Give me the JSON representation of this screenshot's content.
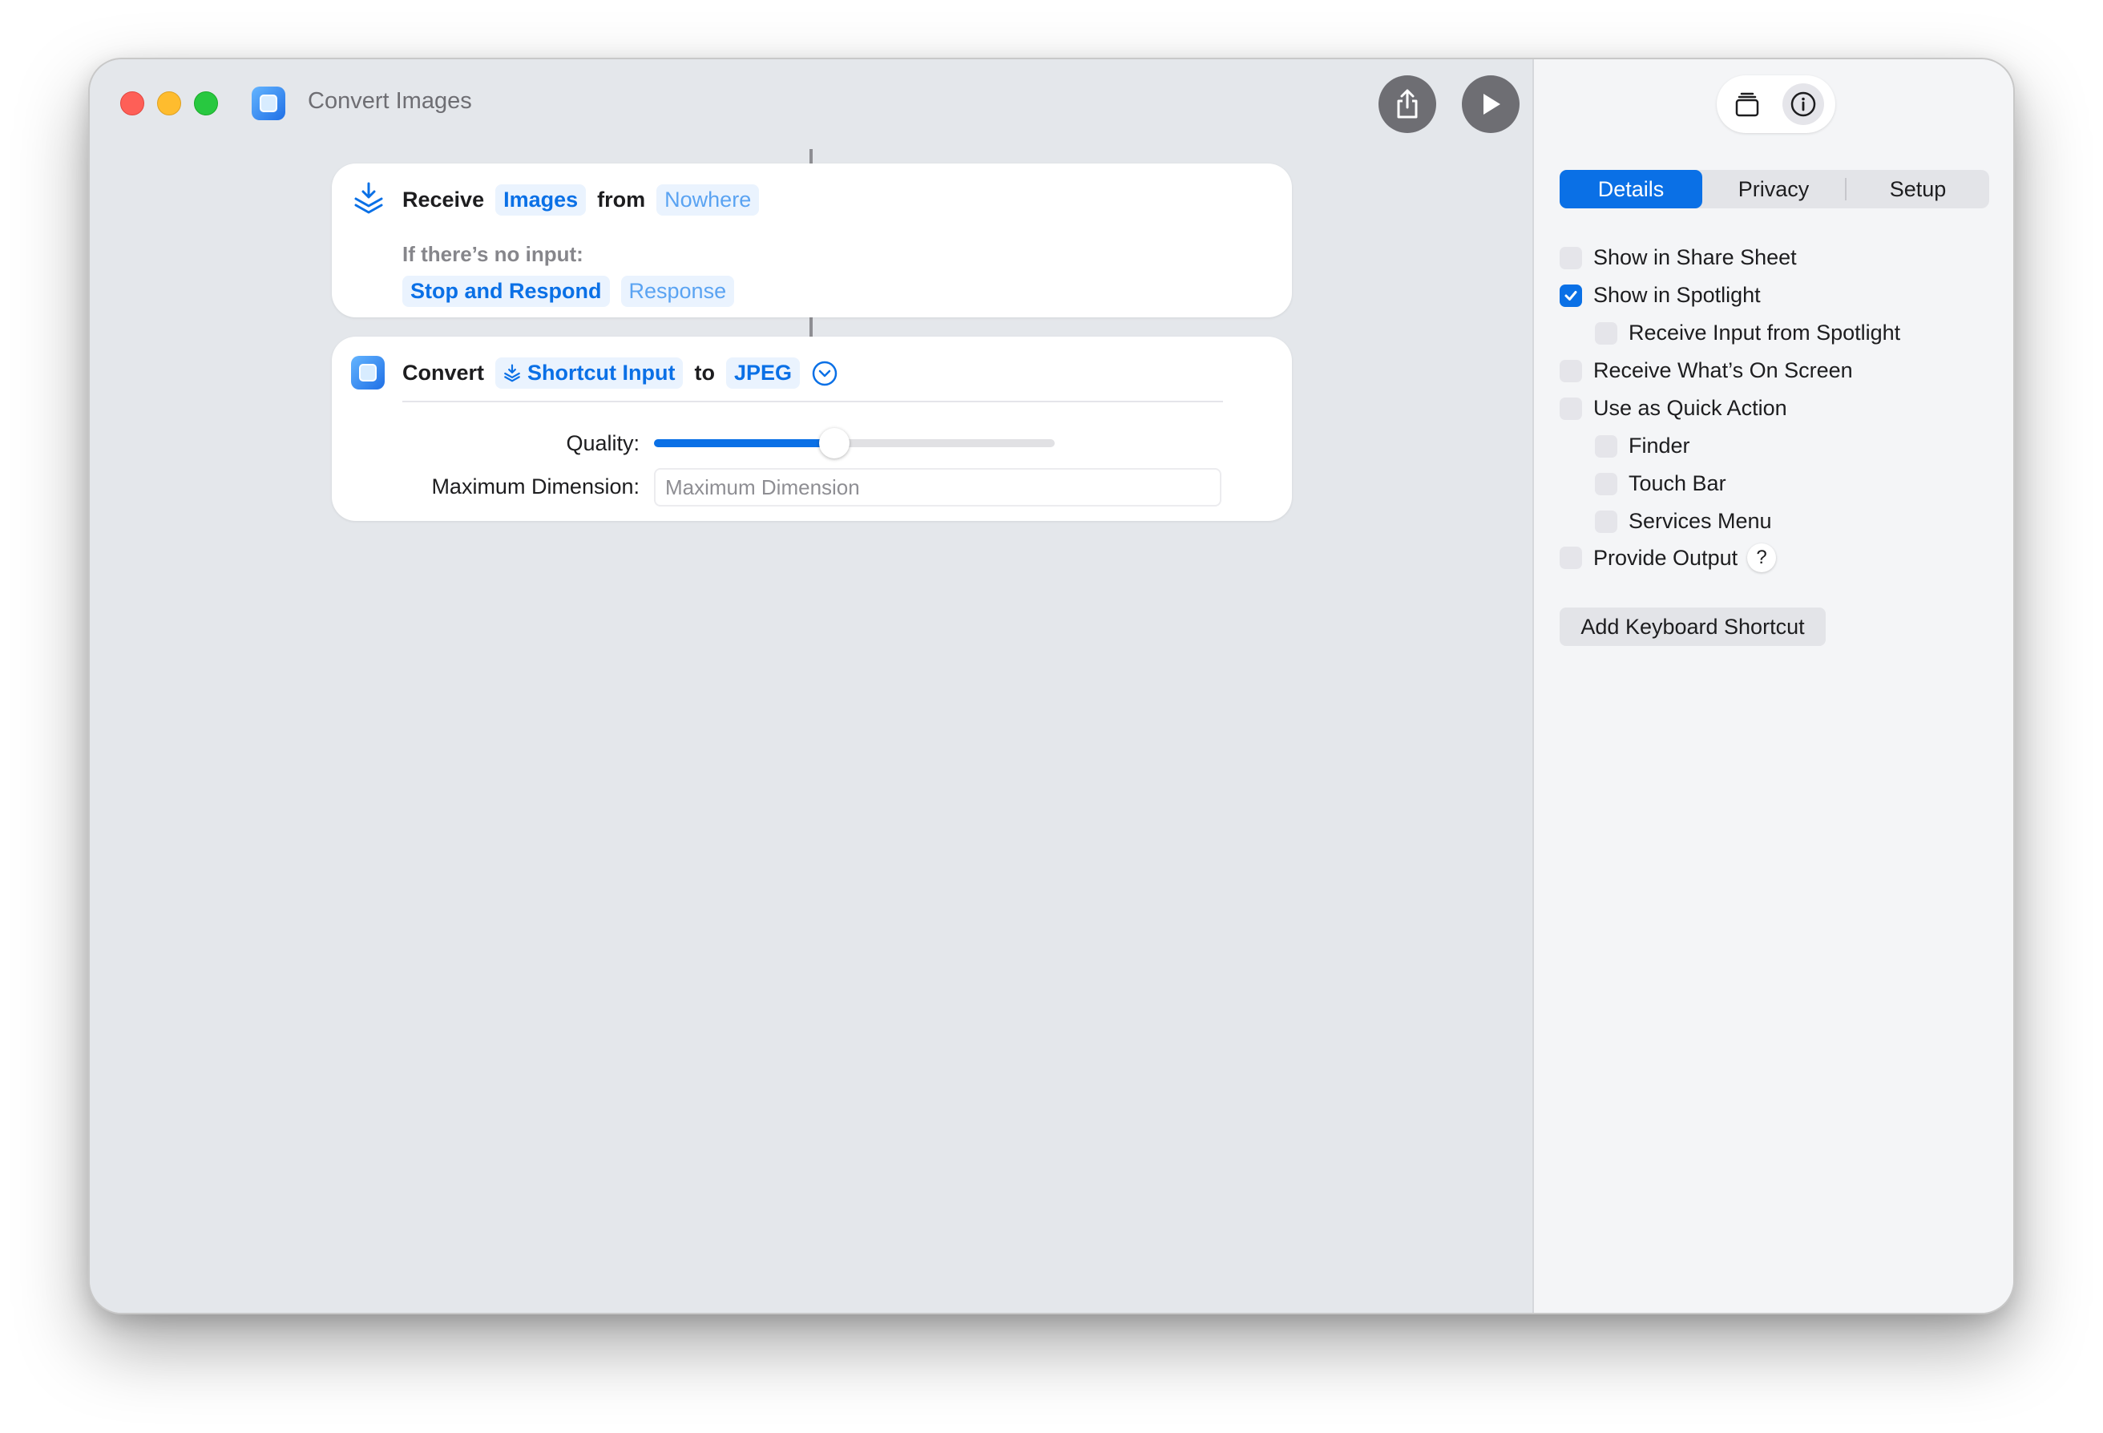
{
  "window": {
    "title": "Convert Images"
  },
  "actions": {
    "receive": {
      "verb": "Receive",
      "type_token": "Images",
      "from_word": "from",
      "source_token": "Nowhere",
      "no_input_label": "If there’s no input:",
      "behavior_token": "Stop and Respond",
      "response_token": "Response"
    },
    "convert": {
      "verb": "Convert",
      "input_token": "Shortcut Input",
      "to_word": "to",
      "format_token": "JPEG",
      "quality_label": "Quality:",
      "quality_value": 0.45,
      "max_dimension_label": "Maximum Dimension:",
      "max_dimension_placeholder": "Maximum Dimension",
      "max_dimension_value": ""
    }
  },
  "sidebar": {
    "tabs": [
      {
        "label": "Details",
        "active": true
      },
      {
        "label": "Privacy",
        "active": false
      },
      {
        "label": "Setup",
        "active": false
      }
    ],
    "options": [
      {
        "label": "Show in Share Sheet",
        "checked": false
      },
      {
        "label": "Show in Spotlight",
        "checked": true
      },
      {
        "label": "Receive Input from Spotlight",
        "checked": false
      },
      {
        "label": "Receive What’s On Screen",
        "checked": false
      },
      {
        "label": "Use as Quick Action",
        "checked": false
      },
      {
        "label": "Finder",
        "checked": false
      },
      {
        "label": "Touch Bar",
        "checked": false
      },
      {
        "label": "Services Menu",
        "checked": false
      },
      {
        "label": "Provide Output",
        "checked": false
      }
    ],
    "help_label": "?",
    "add_shortcut_label": "Add Keyboard Shortcut"
  },
  "colors": {
    "accent": "#0a70e6",
    "token_bg": "#eaf3fe",
    "canvas_bg": "#e4e7eb",
    "sidebar_bg": "#f4f5f7"
  },
  "icons": [
    "app-icon",
    "share-icon",
    "play-icon",
    "receive-icon",
    "convert-icon",
    "variable-icon",
    "chevron-down-icon",
    "library-icon",
    "info-icon",
    "checkmark-icon",
    "help-icon"
  ]
}
